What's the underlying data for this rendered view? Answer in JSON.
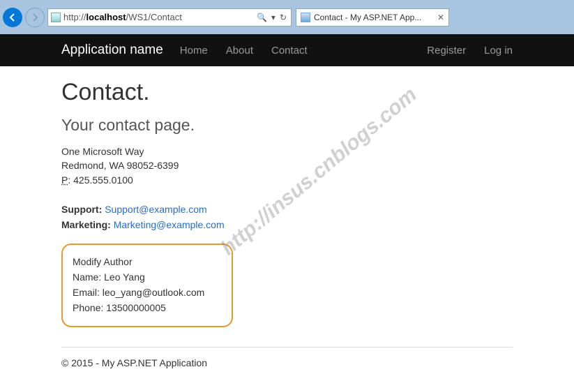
{
  "browser": {
    "url_prefix": "http://",
    "url_host": "localhost",
    "url_path": "/WS1/Contact",
    "tab_title": "Contact - My ASP.NET App..."
  },
  "navbar": {
    "brand": "Application name",
    "home": "Home",
    "about": "About",
    "contact": "Contact",
    "register": "Register",
    "login": "Log in"
  },
  "page": {
    "title": "Contact.",
    "subtitle": "Your contact page.",
    "address_line1": "One Microsoft Way",
    "address_line2": "Redmond, WA 98052-6399",
    "phone_abbr": "P",
    "phone": "425.555.0100",
    "support_label": "Support:",
    "support_email": "Support@example.com",
    "marketing_label": "Marketing:",
    "marketing_email": "Marketing@example.com"
  },
  "author": {
    "heading": "Modify Author",
    "name_label": "Name:",
    "name": "Leo Yang",
    "email_label": "Email:",
    "email": "leo_yang@outlook.com",
    "phone_label": "Phone:",
    "phone": "13500000005"
  },
  "footer": {
    "text": "© 2015 - My ASP.NET Application"
  },
  "watermark": "http://insus.cnblogs.com"
}
